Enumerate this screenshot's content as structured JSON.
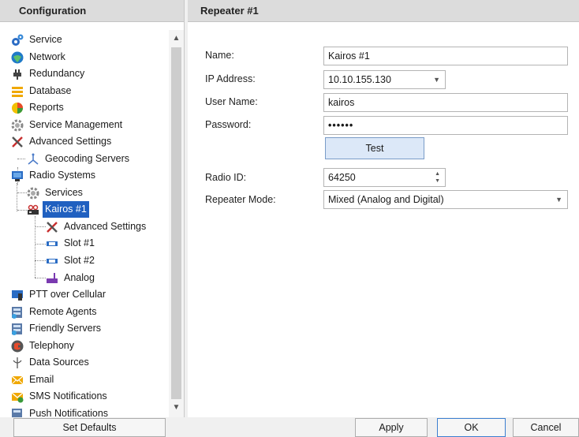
{
  "left_panel": {
    "title": "Configuration",
    "tree": [
      {
        "label": "Service",
        "icon": "service-icon"
      },
      {
        "label": "Network",
        "icon": "network-icon"
      },
      {
        "label": "Redundancy",
        "icon": "redundancy-icon"
      },
      {
        "label": "Database",
        "icon": "database-icon"
      },
      {
        "label": "Reports",
        "icon": "reports-icon"
      },
      {
        "label": "Service Management",
        "icon": "gear-icon"
      },
      {
        "label": "Advanced Settings",
        "icon": "tools-icon"
      },
      {
        "label": "Geocoding Servers",
        "icon": "geocoding-icon"
      },
      {
        "label": "Radio Systems",
        "icon": "radio-systems-icon"
      },
      {
        "label": "Services",
        "icon": "gear-icon"
      },
      {
        "label": "Kairos #1",
        "icon": "repeater-icon"
      },
      {
        "label": "Advanced Settings",
        "icon": "tools-icon"
      },
      {
        "label": "Slot #1",
        "icon": "slot-icon"
      },
      {
        "label": "Slot #2",
        "icon": "slot-icon"
      },
      {
        "label": "Analog",
        "icon": "analog-icon"
      },
      {
        "label": "PTT over Cellular",
        "icon": "ptt-icon"
      },
      {
        "label": "Remote Agents",
        "icon": "remote-agents-icon"
      },
      {
        "label": "Friendly Servers",
        "icon": "friendly-servers-icon"
      },
      {
        "label": "Telephony",
        "icon": "telephony-icon"
      },
      {
        "label": "Data Sources",
        "icon": "data-sources-icon"
      },
      {
        "label": "Email",
        "icon": "email-icon"
      },
      {
        "label": "SMS Notifications",
        "icon": "sms-icon"
      },
      {
        "label": "Push Notifications",
        "icon": "push-icon"
      }
    ]
  },
  "right_panel": {
    "title": "Repeater #1",
    "fields": {
      "name": {
        "label": "Name:",
        "value": "Kairos #1"
      },
      "ip": {
        "label": "IP Address:",
        "value": "10.10.155.130"
      },
      "user": {
        "label": "User Name:",
        "value": "kairos"
      },
      "password": {
        "label": "Password:",
        "value": "••••••"
      },
      "radio_id": {
        "label": "Radio ID:",
        "value": "64250"
      },
      "mode": {
        "label": "Repeater Mode:",
        "value": "Mixed (Analog and Digital)"
      }
    },
    "test_label": "Test"
  },
  "footer": {
    "set_defaults": "Set Defaults",
    "apply": "Apply",
    "ok": "OK",
    "cancel": "Cancel"
  },
  "colors": {
    "selection": "#2060c0",
    "header_bg": "#dcdcdc",
    "test_button_bg": "#dce8f8"
  }
}
